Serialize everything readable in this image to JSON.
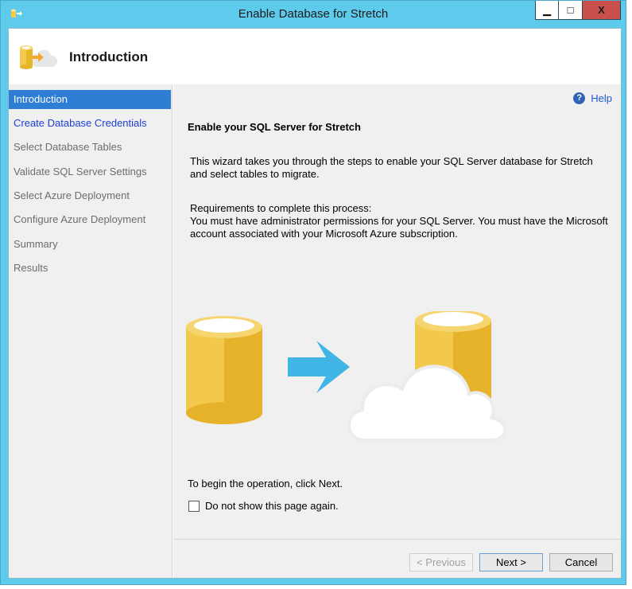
{
  "window": {
    "title": "Enable Database for Stretch",
    "buttons": {
      "minimize": "▁",
      "maximize": "□",
      "close": "X"
    }
  },
  "header": {
    "title": "Introduction",
    "icon": "database-cloud-icon"
  },
  "sidebar": {
    "items": [
      {
        "label": "Introduction",
        "state": "selected"
      },
      {
        "label": "Create Database Credentials",
        "state": "link"
      },
      {
        "label": "Select Database Tables",
        "state": "disabled"
      },
      {
        "label": "Validate SQL Server Settings",
        "state": "disabled"
      },
      {
        "label": "Select Azure Deployment",
        "state": "disabled"
      },
      {
        "label": "Configure Azure Deployment",
        "state": "disabled"
      },
      {
        "label": "Summary",
        "state": "disabled"
      },
      {
        "label": "Results",
        "state": "disabled"
      }
    ]
  },
  "content": {
    "help_label": "Help",
    "help_icon": "?",
    "heading": "Enable your SQL Server for Stretch",
    "paragraph1": "This wizard takes you through the steps to enable your SQL Server database for Stretch and select tables to migrate.",
    "requirements_title": "Requirements to complete this process:",
    "requirements_text": "You must have administrator permissions for your SQL Server. You must have the Microsoft account associated with your Microsoft Azure subscription.",
    "begin_text": "To begin the operation, click Next.",
    "checkbox_label": "Do not show this page again.",
    "checkbox_checked": false
  },
  "footer": {
    "previous_label": "< Previous",
    "next_label": "Next >",
    "cancel_label": "Cancel"
  },
  "colors": {
    "titlebar": "#5fcbec",
    "selected": "#2f7ed6",
    "link": "#1c3fd1",
    "db_gold": "#f2c94c",
    "arrow": "#41b6e6"
  }
}
